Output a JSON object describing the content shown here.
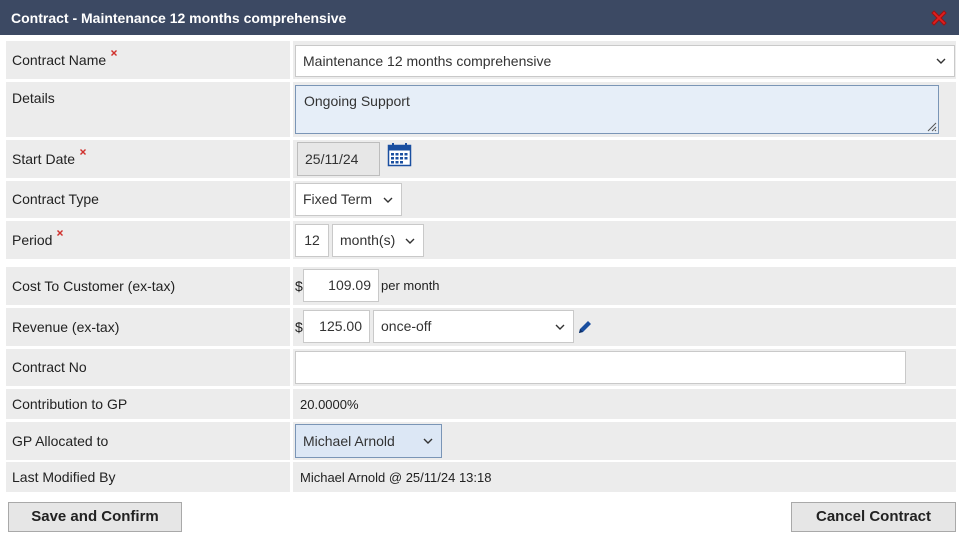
{
  "window": {
    "title": "Contract - Maintenance 12 months comprehensive"
  },
  "labels": {
    "contract_name": "Contract Name",
    "details": "Details",
    "start_date": "Start Date",
    "contract_type": "Contract Type",
    "period": "Period",
    "cost": "Cost To Customer (ex-tax)",
    "revenue": "Revenue (ex-tax)",
    "contract_no": "Contract No",
    "contribution": "Contribution to GP",
    "gp_allocated": "GP Allocated to",
    "last_modified": "Last Modified By"
  },
  "fields": {
    "contract_name": "Maintenance 12 months comprehensive",
    "details": "Ongoing Support",
    "start_date": "25/11/24",
    "contract_type": "Fixed Term",
    "period_value": "12",
    "period_unit": "month(s)",
    "currency": "$",
    "cost_value": "109.09",
    "cost_suffix": "per month",
    "revenue_value": "125.00",
    "revenue_frequency": "once-off",
    "contract_no": "",
    "contribution": "20.0000%",
    "gp_allocated": "Michael Arnold",
    "last_modified": "Michael Arnold @ 25/11/24 13:18"
  },
  "buttons": {
    "save": "Save and Confirm",
    "cancel": "Cancel Contract"
  },
  "icons": {
    "close": "close-icon",
    "required": "required-asterisk-icon",
    "calendar": "calendar-icon",
    "edit": "pencil-icon",
    "dropdown": "chevron-down-icon"
  },
  "colors": {
    "titlebar": "#3c4963",
    "label_bg": "#ececec",
    "required": "#d0312d",
    "textarea_bg": "#e6eef8",
    "focused_select_bg": "#dce7f5"
  }
}
